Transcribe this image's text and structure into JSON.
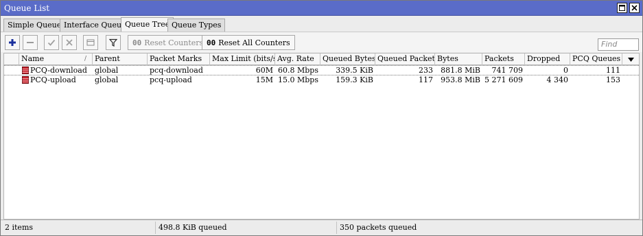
{
  "window": {
    "title": "Queue List"
  },
  "tabs": [
    {
      "label": "Simple Queues"
    },
    {
      "label": "Interface Queues"
    },
    {
      "label": "Queue Tree"
    },
    {
      "label": "Queue Types"
    }
  ],
  "active_tab": "Queue Tree",
  "toolbar": {
    "reset_counters": "Reset Counters",
    "reset_all_counters": "Reset All Counters",
    "counter_glyph": "00",
    "find_placeholder": "Find"
  },
  "table": {
    "columns": [
      "",
      "Name",
      "Parent",
      "Packet Marks",
      "Max Limit (bits/s)",
      "Avg. Rate",
      "Queued Bytes",
      "Queued Packets",
      "Bytes",
      "Packets",
      "Dropped",
      "PCQ Queues"
    ],
    "sort_indicator": "/",
    "rows": [
      {
        "name": "PCQ-download",
        "parent": "global",
        "packet_marks": "pcq-download",
        "max_limit": "60M",
        "avg_rate": "60.8 Mbps",
        "queued_bytes": "339.5 KiB",
        "queued_packets": "233",
        "bytes": "881.8 MiB",
        "packets": "741 709",
        "dropped": "0",
        "pcq_queues": "111"
      },
      {
        "name": "PCQ-upload",
        "parent": "global",
        "packet_marks": "pcq-upload",
        "max_limit": "15M",
        "avg_rate": "15.0 Mbps",
        "queued_bytes": "159.3 KiB",
        "queued_packets": "117",
        "bytes": "953.8 MiB",
        "packets": "5 271 609",
        "dropped": "4 340",
        "pcq_queues": "153"
      }
    ]
  },
  "status": {
    "items": "2 items",
    "queued": "498.8 KiB queued",
    "packets_queued": "350 packets queued"
  },
  "colors": {
    "titlebar": "#5a6cc8",
    "add_icon": "#1a2f9c",
    "queue_icon": "#c8202a"
  }
}
